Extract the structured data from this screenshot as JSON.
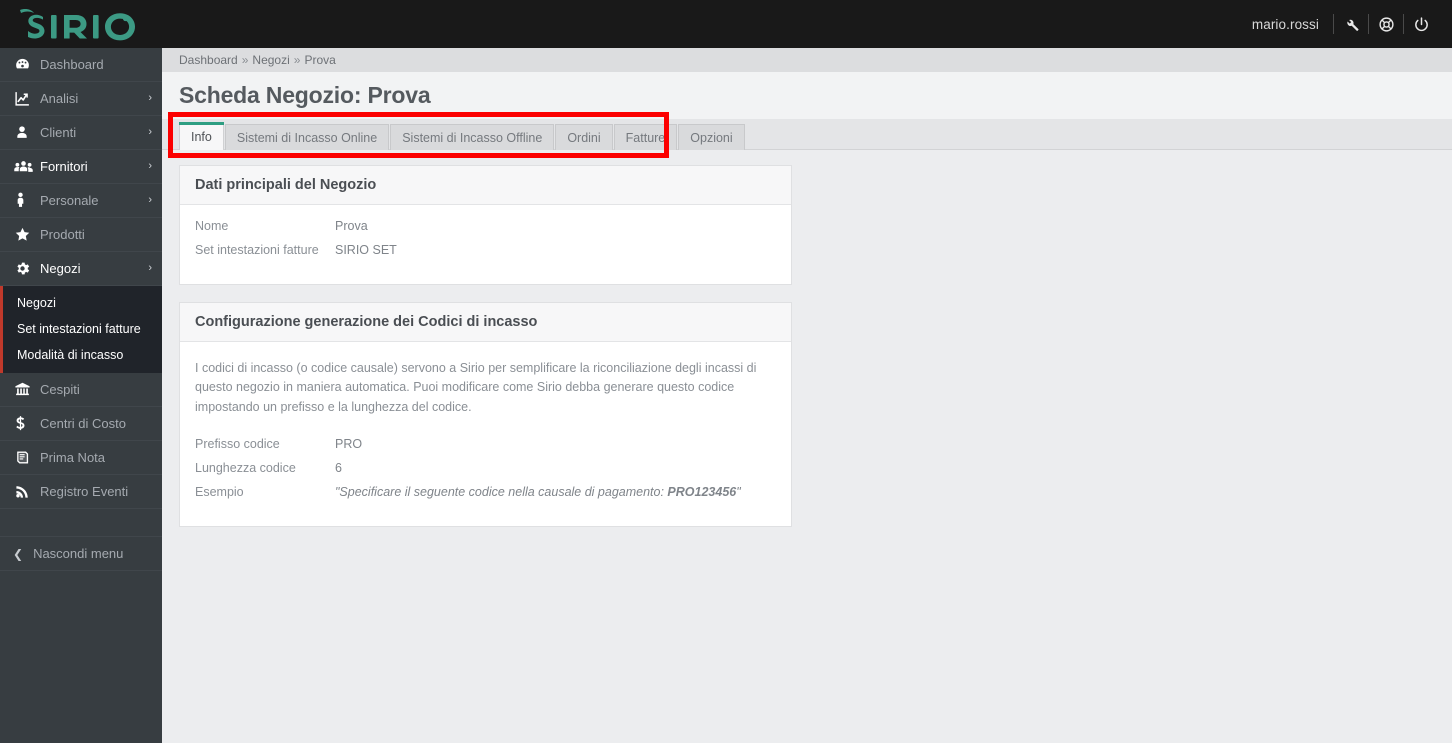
{
  "app": {
    "logo_text": "SIRIO",
    "brand_color": "#3c9a84",
    "highlight_color": "#fc0000",
    "accent_color": "#2e9e82"
  },
  "topbar": {
    "user": "mario.rossi",
    "icons": [
      {
        "name": "wrench-icon",
        "title": "Strumenti"
      },
      {
        "name": "lifebuoy-icon",
        "title": "Aiuto"
      },
      {
        "name": "power-icon",
        "title": "Esci"
      }
    ]
  },
  "sidebar": {
    "items": [
      {
        "label": "Dashboard",
        "icon": "dashboard-icon",
        "caret": "",
        "state": "normal"
      },
      {
        "label": "Analisi",
        "icon": "chart-line-icon",
        "caret": "›",
        "state": "normal"
      },
      {
        "label": "Clienti",
        "icon": "user-icon",
        "caret": "›",
        "state": "normal"
      },
      {
        "label": "Fornitori",
        "icon": "users-icon",
        "caret": "›",
        "state": "hot"
      },
      {
        "label": "Personale",
        "icon": "person-icon",
        "caret": "›",
        "state": "normal"
      },
      {
        "label": "Prodotti",
        "icon": "star-icon",
        "caret": "",
        "state": "normal"
      },
      {
        "label": "Negozi",
        "icon": "gear-icon",
        "caret": "›",
        "state": "open"
      }
    ],
    "submenu": [
      {
        "label": "Negozi"
      },
      {
        "label": "Set intestazioni fatture"
      },
      {
        "label": "Modalità di incasso"
      }
    ],
    "items_after": [
      {
        "label": "Cespiti",
        "icon": "bank-icon",
        "caret": "",
        "state": "normal"
      },
      {
        "label": "Centri di Costo",
        "icon": "dollar-icon",
        "caret": "",
        "state": "normal"
      },
      {
        "label": "Prima Nota",
        "icon": "book-icon",
        "caret": "",
        "state": "normal"
      },
      {
        "label": "Registro Eventi",
        "icon": "rss-icon",
        "caret": "",
        "state": "normal"
      }
    ],
    "hide_menu_label": "Nascondi menu"
  },
  "breadcrumb": {
    "items": [
      "Dashboard",
      "Negozi",
      "Prova"
    ],
    "separator": "»"
  },
  "page": {
    "title": "Scheda Negozio: Prova"
  },
  "tabs": [
    {
      "label": "Info",
      "active": true
    },
    {
      "label": "Sistemi di Incasso Online",
      "active": false
    },
    {
      "label": "Sistemi di Incasso Offline",
      "active": false
    },
    {
      "label": "Ordini",
      "active": false
    },
    {
      "label": "Fatture",
      "active": false
    },
    {
      "label": "Opzioni",
      "active": false
    }
  ],
  "cards": [
    {
      "title": "Dati principali del Negozio",
      "intro": "",
      "rows": [
        {
          "label": "Nome",
          "value": "Prova",
          "italic": false
        },
        {
          "label": "Set intestazioni fatture",
          "value": "SIRIO SET",
          "italic": false
        }
      ]
    },
    {
      "title": "Configurazione generazione dei Codici di incasso",
      "intro": "I codici di incasso (o codice causale) servono a Sirio per semplificare la riconciliazione degli incassi di questo negozio in maniera automatica. Puoi modificare come Sirio debba generare questo codice impostando un prefisso e la lunghezza del codice.",
      "rows": [
        {
          "label": "Prefisso codice",
          "value": "PRO",
          "italic": false
        },
        {
          "label": "Lunghezza codice",
          "value": "6",
          "italic": false
        },
        {
          "label": "Esempio",
          "value_prefix": "\"Specificare il seguente codice nella causale di pagamento: ",
          "value_bold": "PRO123456",
          "value_suffix": "\"",
          "italic": true
        }
      ]
    }
  ]
}
